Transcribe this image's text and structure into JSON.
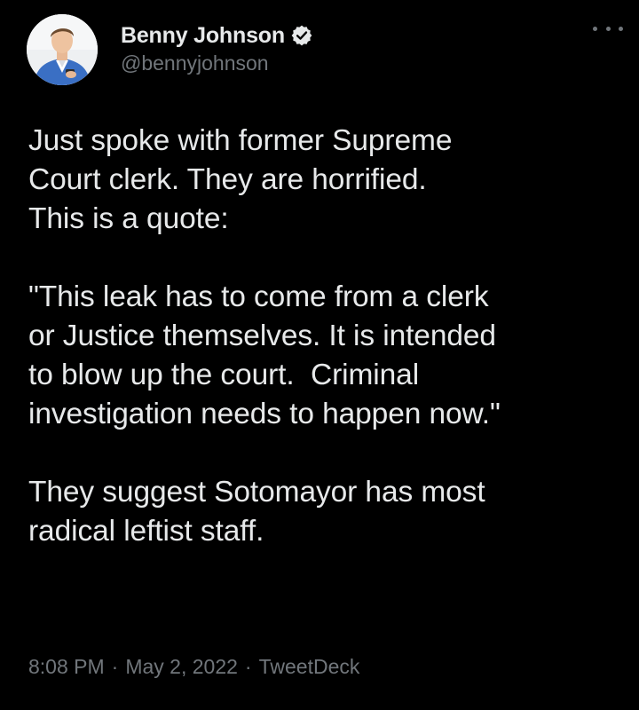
{
  "author": {
    "display_name": "Benny Johnson",
    "handle": "@bennyjohnson",
    "verified": true,
    "avatar_icon": "avatar-photo"
  },
  "tweet": {
    "text": "Just spoke with former Supreme\nCourt clerk. They are horrified.\nThis is a quote:\n\n\"This leak has to come from a clerk\nor Justice themselves. It is intended\nto blow up the court.  Criminal\ninvestigation needs to happen now.\"\n\nThey suggest Sotomayor has most\nradical leftist staff.",
    "time": "8:08 PM",
    "date": "May 2, 2022",
    "source": "TweetDeck",
    "separator": "·"
  },
  "icons": {
    "verified": "verified-badge-icon",
    "more": "more-options-icon"
  },
  "colors": {
    "background": "#000000",
    "text_primary": "#e7e9ea",
    "text_secondary": "#71767b",
    "verified_badge": "#e7e9ea"
  }
}
